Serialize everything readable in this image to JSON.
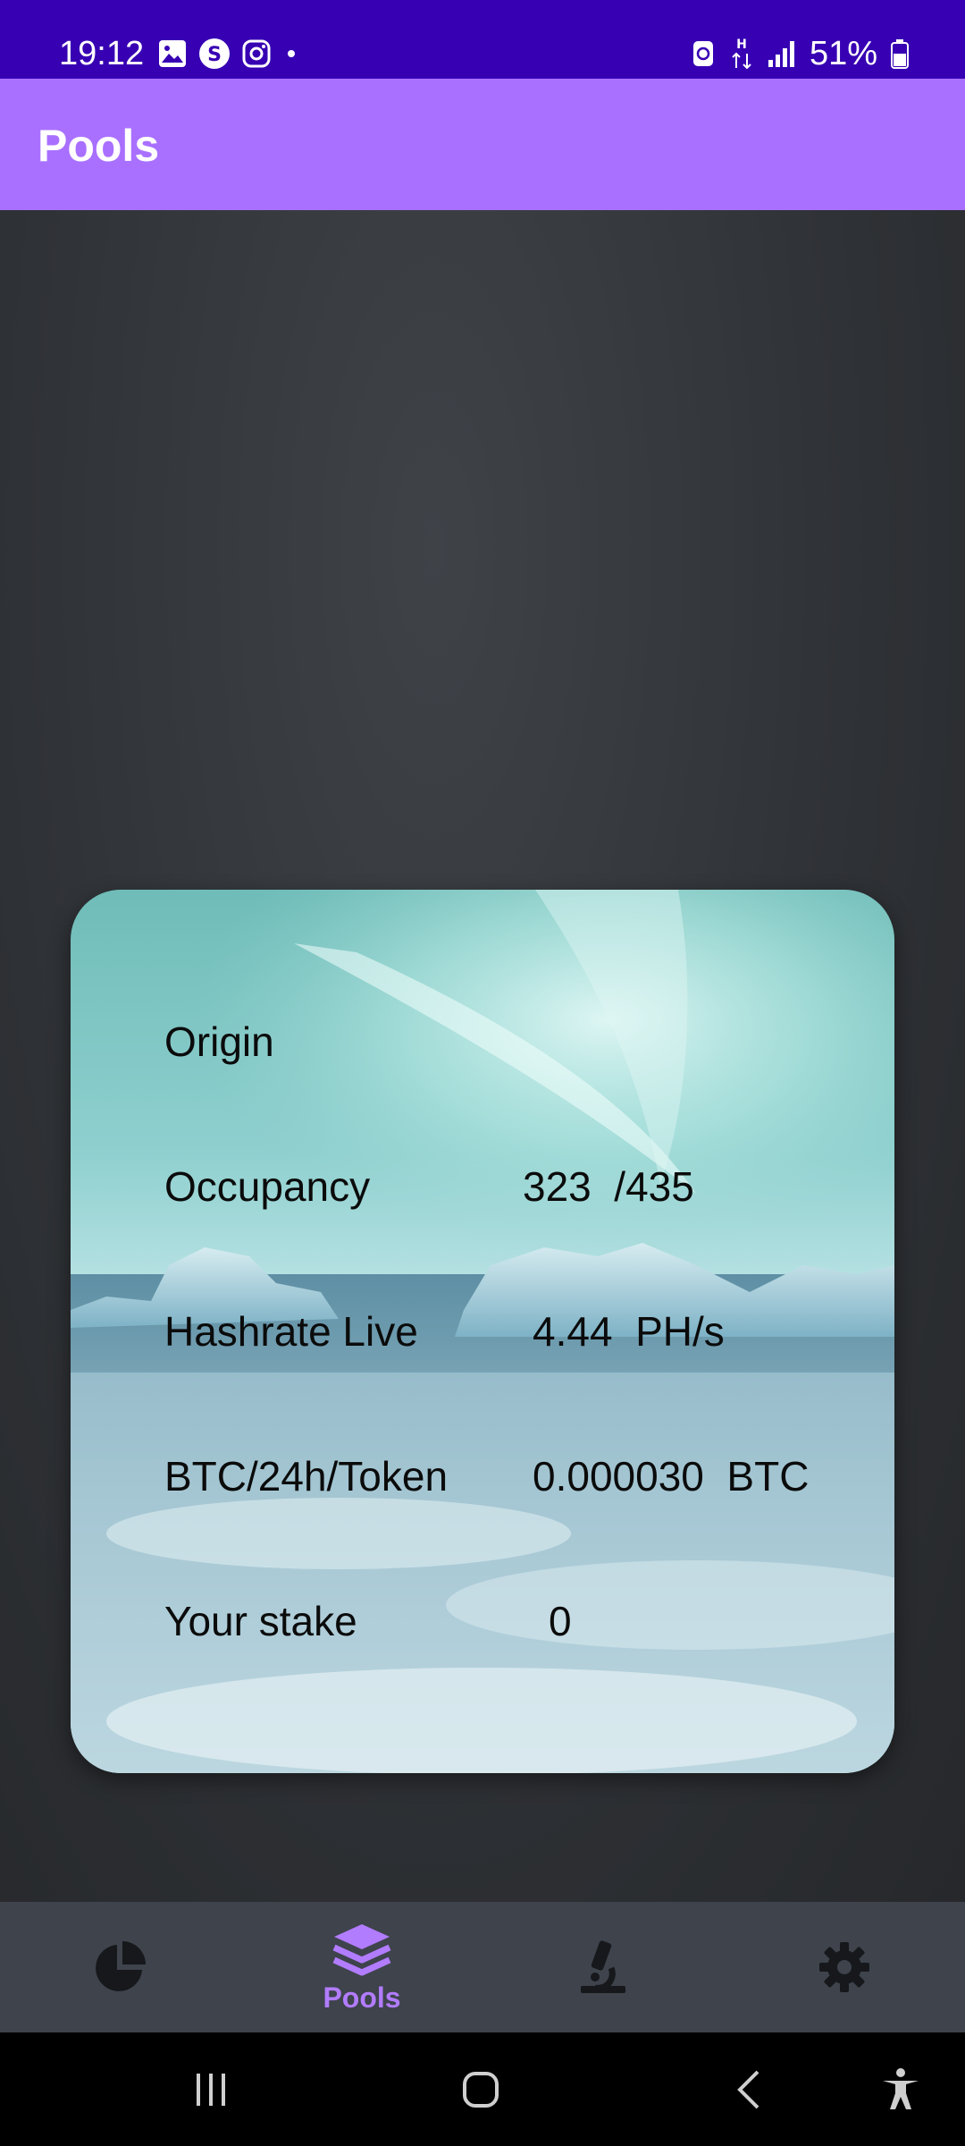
{
  "status_bar": {
    "time": "19:12",
    "battery_percent": "51%",
    "left_icons": [
      "gallery-icon",
      "threads-icon",
      "instagram-icon",
      "dot-icon"
    ],
    "right_icons": [
      "data-saver-icon",
      "hplus-signal-icon",
      "cell-signal-icon",
      "battery-icon"
    ]
  },
  "app_bar": {
    "title": "Pools"
  },
  "pool_card": {
    "rows": [
      {
        "label": "Origin",
        "value": ""
      },
      {
        "label": "Occupancy",
        "value": "323  /435"
      },
      {
        "label": "Hashrate Live",
        "value": "4.44  PH/s"
      },
      {
        "label": "BTC/24h/Token",
        "value": "0.000030  BTC"
      },
      {
        "label": "Your stake",
        "value": "0"
      }
    ]
  },
  "bottom_nav": {
    "items": [
      {
        "icon": "pie-chart-icon",
        "label": ""
      },
      {
        "icon": "layers-icon",
        "label": "Pools",
        "active": true
      },
      {
        "icon": "microscope-icon",
        "label": ""
      },
      {
        "icon": "gear-icon",
        "label": ""
      }
    ]
  },
  "system_nav": {
    "icons": [
      "recents-icon",
      "home-icon",
      "back-icon",
      "accessibility-icon"
    ]
  },
  "colors": {
    "status_bar": "#3700b3",
    "app_bar": "#a970ff",
    "accent": "#b27cff",
    "nav_bg": "#3e434c"
  }
}
